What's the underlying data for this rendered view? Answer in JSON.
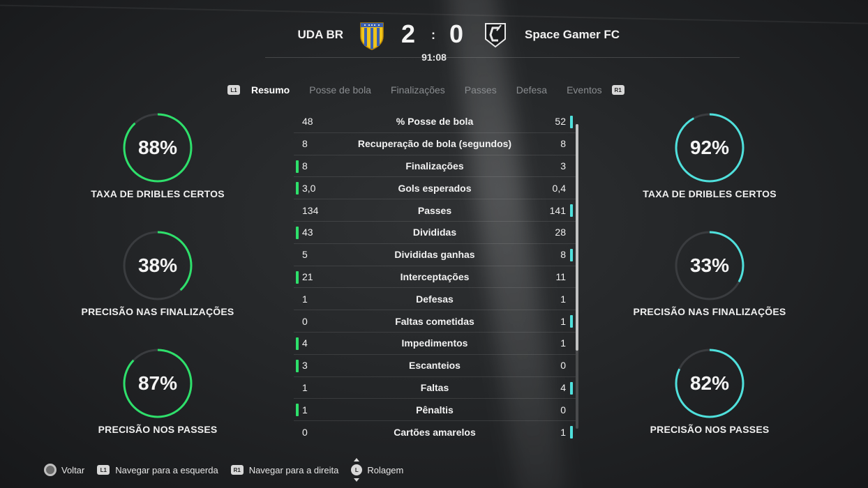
{
  "match": {
    "home_team": "UDA BR",
    "away_team": "Space Gamer FC",
    "home_score": "2",
    "separator": ":",
    "away_score": "0",
    "clock": "91:08"
  },
  "tabs": {
    "left_button": "L1",
    "right_button": "R1",
    "items": [
      "Resumo",
      "Posse de bola",
      "Finalizações",
      "Passes",
      "Defesa",
      "Eventos"
    ],
    "active": "Resumo"
  },
  "home_rings": [
    {
      "value": "88%",
      "fraction": 0.88,
      "label": "TAXA DE DRIBLES CERTOS"
    },
    {
      "value": "38%",
      "fraction": 0.38,
      "label": "PRECISÃO NAS FINALIZAÇÕES"
    },
    {
      "value": "87%",
      "fraction": 0.87,
      "label": "PRECISÃO NOS PASSES"
    }
  ],
  "away_rings": [
    {
      "value": "92%",
      "fraction": 0.92,
      "label": "TAXA DE DRIBLES CERTOS"
    },
    {
      "value": "33%",
      "fraction": 0.33,
      "label": "PRECISÃO NAS FINALIZAÇÕES"
    },
    {
      "value": "82%",
      "fraction": 0.82,
      "label": "PRECISÃO NOS PASSES"
    }
  ],
  "stats": [
    {
      "label": "% Posse de bola",
      "home": "48",
      "away": "52",
      "leader": "away"
    },
    {
      "label": "Recuperação de bola (segundos)",
      "home": "8",
      "away": "8",
      "leader": "none"
    },
    {
      "label": "Finalizações",
      "home": "8",
      "away": "3",
      "leader": "home"
    },
    {
      "label": "Gols esperados",
      "home": "3,0",
      "away": "0,4",
      "leader": "home"
    },
    {
      "label": "Passes",
      "home": "134",
      "away": "141",
      "leader": "away"
    },
    {
      "label": "Divididas",
      "home": "43",
      "away": "28",
      "leader": "home"
    },
    {
      "label": "Divididas ganhas",
      "home": "5",
      "away": "8",
      "leader": "away"
    },
    {
      "label": "Interceptações",
      "home": "21",
      "away": "11",
      "leader": "home"
    },
    {
      "label": "Defesas",
      "home": "1",
      "away": "1",
      "leader": "none"
    },
    {
      "label": "Faltas cometidas",
      "home": "0",
      "away": "1",
      "leader": "away"
    },
    {
      "label": "Impedimentos",
      "home": "4",
      "away": "1",
      "leader": "home"
    },
    {
      "label": "Escanteios",
      "home": "3",
      "away": "0",
      "leader": "home"
    },
    {
      "label": "Faltas",
      "home": "1",
      "away": "4",
      "leader": "away"
    },
    {
      "label": "Pênaltis",
      "home": "1",
      "away": "0",
      "leader": "home"
    },
    {
      "label": "Cartões amarelos",
      "home": "0",
      "away": "1",
      "leader": "away"
    }
  ],
  "colors": {
    "home_accent": "#2ee06b",
    "away_accent": "#4fe0dc",
    "ring_track": "#3a3c3f"
  },
  "footer": {
    "back": "Voltar",
    "nav_left_button": "L1",
    "nav_left": "Navegar para a esquerda",
    "nav_right_button": "R1",
    "nav_right": "Navegar para a direita",
    "scroll_button": "L",
    "scroll": "Rolagem"
  }
}
